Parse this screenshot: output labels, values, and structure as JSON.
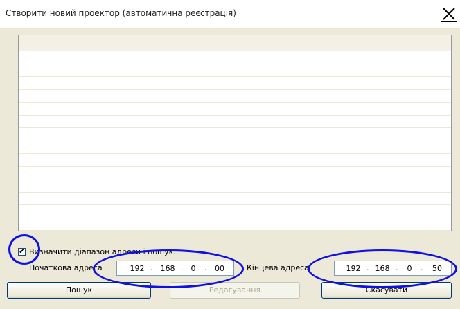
{
  "window": {
    "title": "Створити новий проектор (автоматична реєстрація)"
  },
  "list": {
    "columns": [],
    "rows": []
  },
  "options": {
    "range_checkbox_label": "Визначити діапазон адреси і пошук.",
    "range_checked": true,
    "start_address_label": "Початкова адреса",
    "start_address": [
      "192",
      "168",
      "0",
      "00"
    ],
    "end_address_label": "Кінцева адреса",
    "end_address": [
      "192",
      "168",
      "0",
      "50"
    ]
  },
  "buttons": {
    "search": "Пошук",
    "edit": "Редагування",
    "cancel": "Скасувати"
  },
  "colors": {
    "annotation": "#1010e6",
    "list_header": "#f3f1e6",
    "window_bg": "#ece9d8"
  },
  "icons": {
    "close": "close-x-icon",
    "check": "checkmark-icon"
  }
}
